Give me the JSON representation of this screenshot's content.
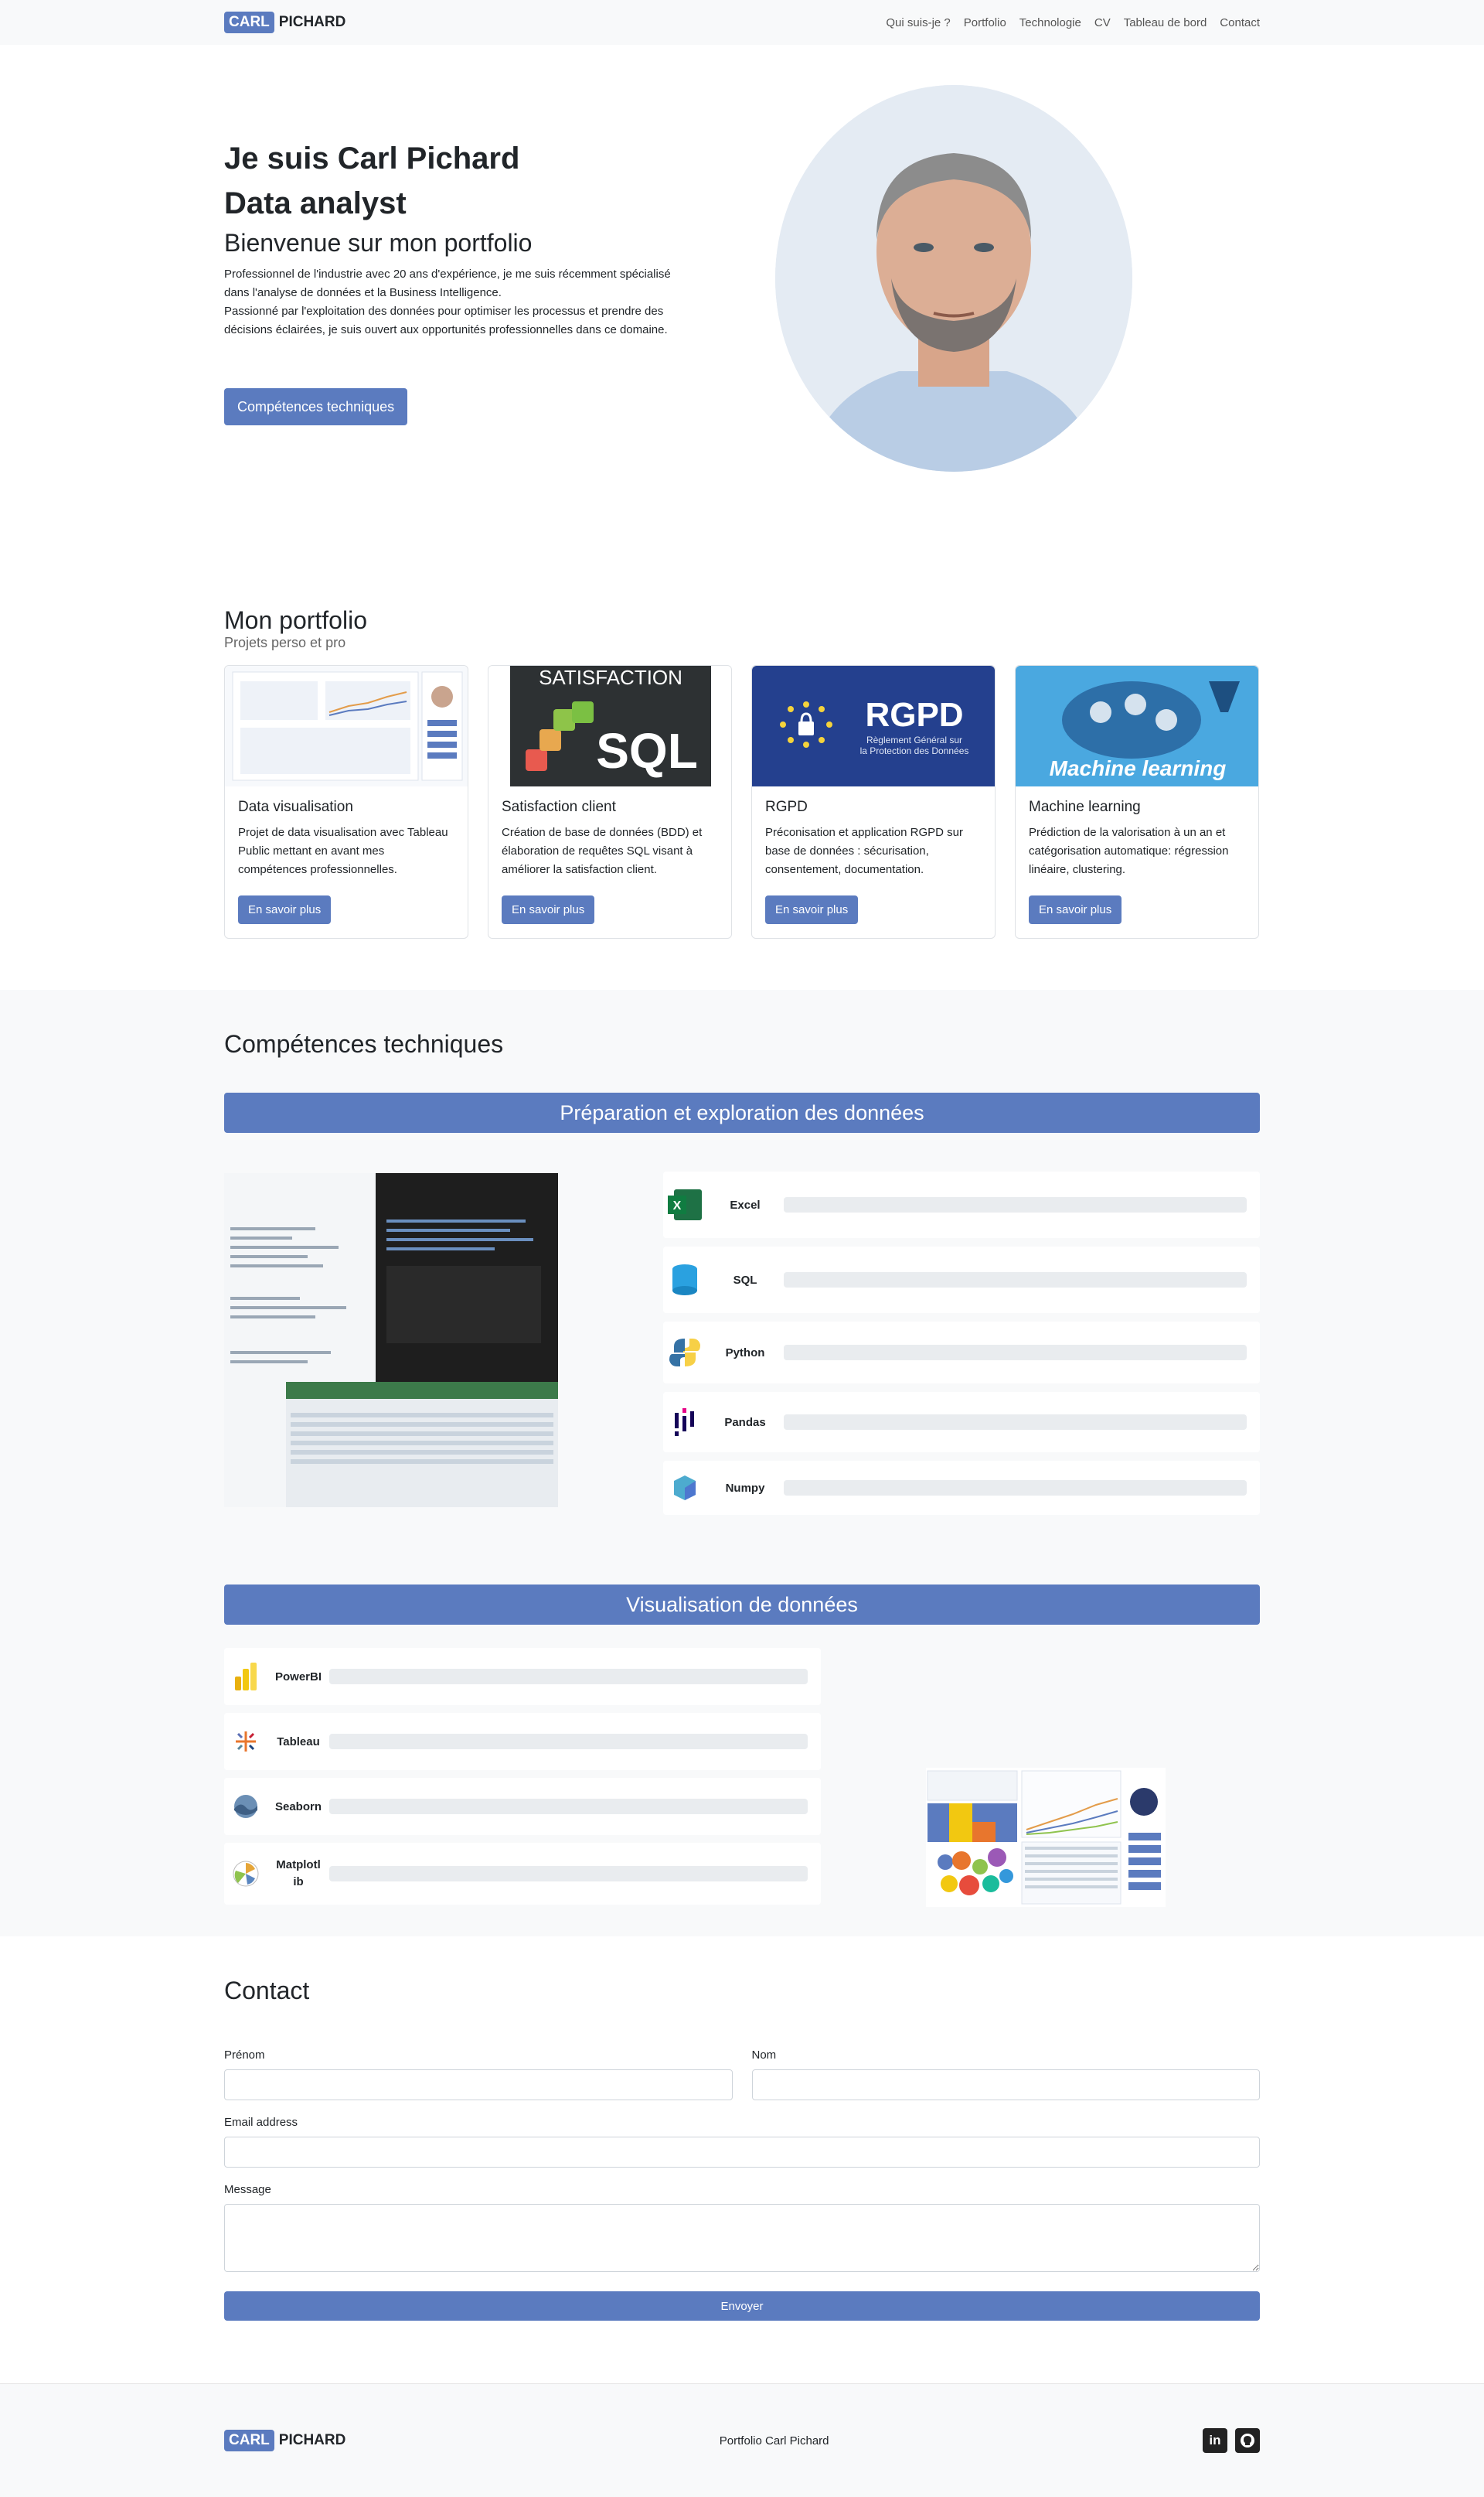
{
  "nav": {
    "brand_box": "CARL",
    "brand_text": "PICHARD",
    "links": [
      "Qui suis-je ?",
      "Portfolio",
      "Technologie",
      "CV",
      "Tableau de bord",
      "Contact"
    ]
  },
  "hero": {
    "title_line1": "Je suis Carl Pichard",
    "title_line2": "Data analyst",
    "subtitle": "Bienvenue sur mon portfolio",
    "desc": [
      "Professionnel de l'industrie avec 20 ans d'expérience, je me suis récemment spécialisé",
      "dans l'analyse de données et la Business Intelligence.",
      "Passionné par l'exploitation des données pour optimiser les processus et prendre des",
      "décisions éclairées, je suis ouvert aux opportunités professionnelles dans ce domaine."
    ],
    "button": "Compétences techniques"
  },
  "portfolio": {
    "title": "Mon portfolio",
    "subtitle": "Projets perso et pro",
    "image_texts": {
      "satisfaction": "SATISFACTION",
      "sql": "SQL",
      "rgpd": "RGPD",
      "rgpd_sub1": "Règlement Général sur",
      "rgpd_sub2": "la Protection des Données",
      "ml": "Machine learning"
    },
    "cards": [
      {
        "title": "Data visualisation",
        "text": "Projet de data visualisation avec Tableau Public mettant en avant mes compétences professionnelles.",
        "button": "En savoir plus"
      },
      {
        "title": "Satisfaction client",
        "text": "Création de base de données (BDD) et élaboration de requêtes SQL visant à améliorer la satisfaction client.",
        "button": "En savoir plus"
      },
      {
        "title": "RGPD",
        "text": "Préconisation et application RGPD sur base de données : sécurisation, consentement, documentation.",
        "button": "En savoir plus"
      },
      {
        "title": "Machine learning",
        "text": "Prédiction de la valorisation à un an et catégorisation automatique: régression linéaire, clustering.",
        "button": "En savoir plus"
      }
    ]
  },
  "skills": {
    "title": "Compétences techniques",
    "band1": "Préparation et exploration des données",
    "band2": "Visualisation de données",
    "prep": [
      "Excel",
      "SQL",
      "Python",
      "Pandas",
      "Numpy"
    ],
    "viz": [
      "PowerBI",
      "Tableau",
      "Seaborn",
      "Matplotlib"
    ]
  },
  "contact": {
    "title": "Contact",
    "prenom": "Prénom",
    "nom": "Nom",
    "email": "Email address",
    "message": "Message",
    "submit": "Envoyer"
  },
  "footer": {
    "brand_box": "CARL",
    "brand_text": "PICHARD",
    "center": "Portfolio Carl Pichard",
    "linkedin": "in"
  },
  "colors": {
    "accent": "#5b7bbf",
    "light_bg": "#f8f9fa"
  }
}
